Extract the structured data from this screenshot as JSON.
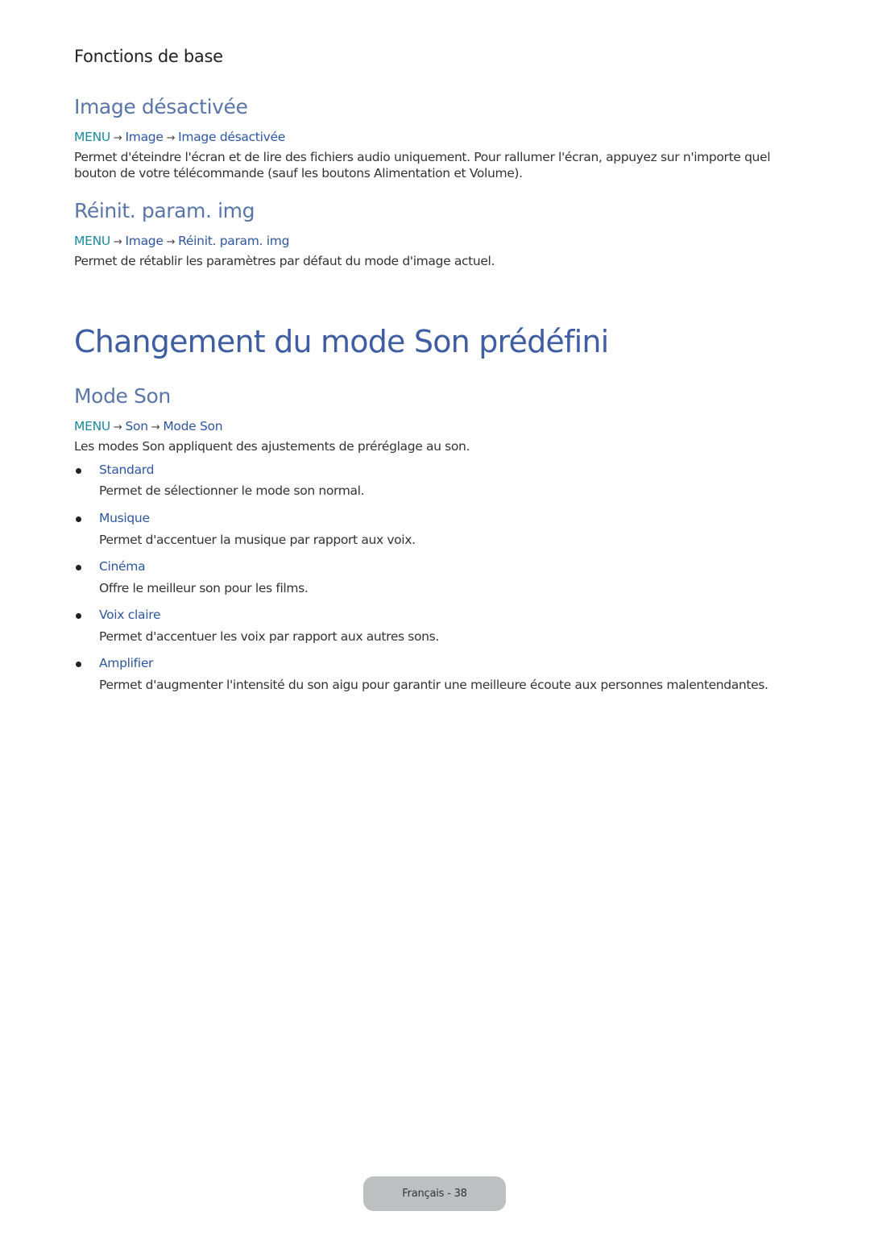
{
  "header": {
    "chapter": "Fonctions de base"
  },
  "sections": {
    "image_off": {
      "title": "Image désactivée",
      "path": {
        "menu": "MENU",
        "arrow": "→",
        "level1": "Image",
        "level2": "Image désactivée"
      },
      "line1": "Permet d'éteindre l'écran et de lire des fichiers audio uniquement. Pour rallumer l'écran, appuyez sur n'importe quel",
      "line2": "bouton de votre télécommande (sauf les boutons Alimentation et Volume)."
    },
    "reset": {
      "title": "Réinit. param. img",
      "path": {
        "menu": "MENU",
        "arrow": "→",
        "level1": "Image",
        "level2": "Réinit. param. img"
      },
      "line1": "Permet de rétablir les paramètres par défaut du mode d'image actuel."
    }
  },
  "chapter_title": "Changement du mode Son prédéfini",
  "sound_mode": {
    "title": "Mode Son",
    "path": {
      "menu": "MENU",
      "arrow": "→",
      "level1": "Son",
      "level2": "Mode Son"
    },
    "intro": "Les modes Son appliquent des ajustements de préréglage au son.",
    "items": [
      {
        "label": "Standard",
        "desc": "Permet de sélectionner le mode son normal."
      },
      {
        "label": "Musique",
        "desc": "Permet d'accentuer la musique par rapport aux voix."
      },
      {
        "label": "Cinéma",
        "desc": "Offre le meilleur son pour les films."
      },
      {
        "label": "Voix claire",
        "desc": "Permet d'accentuer les voix par rapport aux autres sons."
      },
      {
        "label": "Amplifier",
        "desc": "Permet d'augmenter l'intensité du son aigu pour garantir une meilleure écoute aux personnes malentendantes."
      }
    ]
  },
  "footer": {
    "page_label": "Français - 38"
  },
  "colors": {
    "heading": "#5a76a8",
    "chapter_title": "#3e5da2",
    "menu": "#1a8a9f",
    "path": "#2e57a0",
    "footer_bg": "#bebfc1"
  }
}
